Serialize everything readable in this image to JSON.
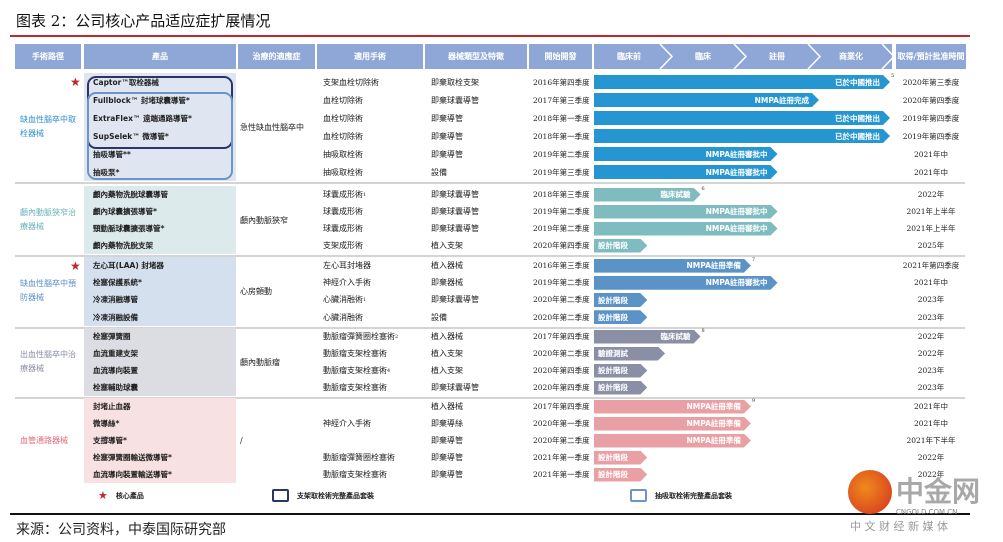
{
  "title": "图表 2：公司核心产品适应症扩展情况",
  "headers": {
    "pathway": "手術路徑",
    "product": "產品",
    "indication": "治療的適應症",
    "surgery": "適用手術",
    "device_type": "器械類型及特徵",
    "start_dev": "開始開發",
    "stages": [
      "臨床前",
      "臨床",
      "註冊",
      "商業化"
    ],
    "approval": "取得/預計批准時間"
  },
  "colors": {
    "header": "#8fa7d6",
    "title_line": "#c0282d"
  },
  "groups": [
    {
      "label": "缺血性腦卒中取栓器械",
      "label_color": "#2f8fd0",
      "cell_bg": "#dfe6f2",
      "bar_color": "#2596d1",
      "indication": "急性缺血性腦卒中",
      "rows": [
        {
          "product": "Captor™取栓器械",
          "star": true,
          "surgery": "支架血栓切除術",
          "sup": "",
          "type": "即棄取栓支架",
          "start": "2016年第四季度",
          "stage": "已於中國推出",
          "progress": 1.0,
          "note": "5",
          "approval": "2020年第三季度"
        },
        {
          "product": "Fullblock™ 封堵球囊導管*",
          "surgery": "血栓切除術",
          "sup": "",
          "type": "即棄球囊導管",
          "start": "2017年第三季度",
          "stage": "NMPA註冊完成",
          "progress": 0.76,
          "approval": "2020年第四季度"
        },
        {
          "product": "ExtraFlex™ 遠端通路導管*",
          "surgery": "血栓切除術",
          "sup": "",
          "type": "即棄導管",
          "start": "2018年第一季度",
          "stage": "已於中國推出",
          "progress": 1.0,
          "approval": "2019年第四季度"
        },
        {
          "product": "SupSelek™ 微導管*",
          "surgery": "血栓切除術",
          "sup": "",
          "type": "即棄導管",
          "start": "2018年第一季度",
          "stage": "已於中國推出",
          "progress": 1.0,
          "approval": "2019年第四季度"
        },
        {
          "product": "抽吸導管**",
          "surgery": "抽吸取栓術",
          "sup": "",
          "type": "即棄導管",
          "start": "2019年第二季度",
          "stage": "NMPA註冊審批中",
          "progress": 0.62,
          "approval": "2021年中"
        },
        {
          "product": "抽吸泵*",
          "surgery": "抽吸取栓術",
          "sup": "",
          "type": "設備",
          "start": "2019年第三季度",
          "stage": "NMPA註冊審批中",
          "progress": 0.62,
          "approval": "2021年中"
        }
      ]
    },
    {
      "label": "顱內動脈狹窄治療器械",
      "label_color": "#6ab1b7",
      "cell_bg": "#dceaeb",
      "bar_color": "#7fbcc0",
      "indication": "顱內動脈狹窄",
      "rows": [
        {
          "product": "顱內藥物洗脫球囊導管",
          "surgery": "球囊成形術",
          "sup": "1",
          "type": "即棄球囊導管",
          "start": "2018年第三季度",
          "stage": "臨床試驗",
          "progress": 0.36,
          "note": "6",
          "approval": "2022年"
        },
        {
          "product": "顱內球囊擴張導管*",
          "surgery": "球囊成形術",
          "sup": "",
          "type": "即棄球囊導管",
          "start": "2019年第二季度",
          "stage": "NMPA註冊審批中",
          "progress": 0.62,
          "approval": "2021年上半年"
        },
        {
          "product": "頸動脈球囊擴張導管*",
          "surgery": "球囊成形術",
          "sup": "",
          "type": "即棄球囊導管",
          "start": "2019年第二季度",
          "stage": "NMPA註冊審批中",
          "progress": 0.62,
          "approval": "2021年上半年"
        },
        {
          "product": "顱內藥物洗脫支架",
          "surgery": "支架成形術",
          "sup": "",
          "type": "植入支架",
          "start": "2020年第四季度",
          "stage": "設計階段",
          "progress": 0.18,
          "approval": "2025年"
        }
      ]
    },
    {
      "label": "缺血性腦卒中預防器械",
      "label_color": "#5b8fc9",
      "cell_bg": "#d5e0ee",
      "bar_color": "#5b93c7",
      "indication": "心房顫動",
      "rows": [
        {
          "product": "左心耳(LAA) 封堵器",
          "star": true,
          "surgery": "左心耳封堵器",
          "sup": "",
          "type": "植入器械",
          "start": "2016年第三季度",
          "stage": "NMPA註冊準備",
          "progress": 0.53,
          "note": "7",
          "approval": "2021年第四季度"
        },
        {
          "product": "栓塞保護系統*",
          "surgery": "神經介入手術",
          "sup": "",
          "type": "即棄器械",
          "start": "2019年第二季度",
          "stage": "NMPA註冊審批中",
          "progress": 0.62,
          "approval": "2021年中"
        },
        {
          "product": "冷凍消融導管",
          "surgery": "心臟消融術",
          "sup": "1",
          "type": "即棄球囊導管",
          "start": "2020年第二季度",
          "stage": "設計階段",
          "progress": 0.18,
          "approval": "2023年"
        },
        {
          "product": "冷凍消融設備",
          "surgery": "心臟消融術",
          "sup": "",
          "type": "設備",
          "start": "2020年第二季度",
          "stage": "設計階段",
          "progress": 0.18,
          "approval": "2023年"
        }
      ]
    },
    {
      "label": "出血性腦卒中治療器械",
      "label_color": "#8a8fa6",
      "cell_bg": "#dcdde2",
      "bar_color": "#8a8fa6",
      "indication": "顱內動脈瘤",
      "rows": [
        {
          "product": "栓塞彈簧圈",
          "surgery": "動脈瘤彈簧圈栓塞術",
          "sup": "2",
          "type": "植入器械",
          "start": "2017年第四季度",
          "stage": "臨床試驗",
          "progress": 0.36,
          "note": "8",
          "approval": "2022年"
        },
        {
          "product": "血流重建支架",
          "surgery": "動脈瘤支架栓塞術",
          "sup": "",
          "type": "植入支架",
          "start": "2020年第二季度",
          "stage": "驗證測試",
          "progress": 0.24,
          "approval": "2022年"
        },
        {
          "product": "血流導向裝置",
          "surgery": "動脈瘤支架栓塞術",
          "sup": "4",
          "type": "植入支架",
          "start": "2020年第四季度",
          "stage": "設計階段",
          "progress": 0.18,
          "approval": "2023年"
        },
        {
          "product": "栓塞輔助球囊",
          "surgery": "動脈瘤支架栓塞術",
          "sup": "",
          "type": "即棄球囊導管",
          "start": "2020年第四季度",
          "stage": "設計階段",
          "progress": 0.18,
          "approval": "2023年"
        }
      ]
    },
    {
      "label": "血管通路器械",
      "label_color": "#e36b75",
      "cell_bg": "#f8e1e2",
      "bar_color": "#e9a0a5",
      "indication": "/",
      "rows": [
        {
          "product": "封堵止血器",
          "surgery": "",
          "sup": "",
          "type": "植入器械",
          "start": "2017年第四季度",
          "stage": "NMPA註冊準備",
          "progress": 0.53,
          "note": "9",
          "approval": "2021年中"
        },
        {
          "product": "微導絲*",
          "surgery": "神經介入手術",
          "sup": "",
          "type": "即棄導絲",
          "start": "2020年第一季度",
          "stage": "NMPA註冊準備",
          "progress": 0.53,
          "approval": "2021年中"
        },
        {
          "product": "支撐導管*",
          "surgery": "",
          "sup": "",
          "type": "即棄導管",
          "start": "2020年第二季度",
          "stage": "NMPA註冊準備",
          "progress": 0.53,
          "approval": "2021年下半年"
        },
        {
          "product": "栓塞彈簧圈輸送微導管*",
          "surgery": "動脈瘤彈簧圈栓塞術",
          "sup": "",
          "type": "即棄導管",
          "start": "2021年第一季度",
          "stage": "設計階段",
          "progress": 0.18,
          "approval": "2022年"
        },
        {
          "product": "血流導向裝置輸送導管*",
          "surgery": "動脈瘤支架栓塞術",
          "sup": "",
          "type": "即棄導管",
          "start": "2021年第一季度",
          "stage": "設計階段",
          "progress": 0.18,
          "approval": "2022年"
        }
      ]
    }
  ],
  "legend": {
    "core": "核心產品",
    "stent_box": "支架取栓術完整產品套裝",
    "aspiration_box": "抽吸取栓術完整產品套裝"
  },
  "source": "来源：公司资料，中泰国际研究部",
  "watermark": {
    "name": "中金网",
    "domain": "CNGOLD.COM.CN",
    "slogan": "中 文 财 经 新 媒 体"
  }
}
